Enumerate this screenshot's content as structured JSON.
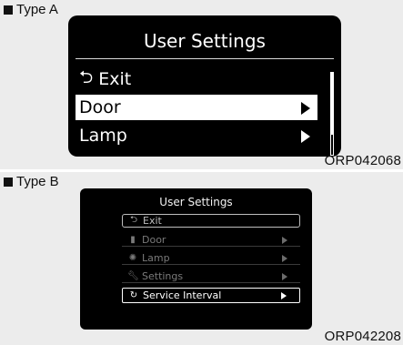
{
  "type_a": {
    "label": "Type A",
    "code": "ORP042068",
    "screen_title": "User Settings",
    "items": [
      {
        "label": "Exit",
        "icon": "back-arrow-icon",
        "has_arrow": false,
        "selected": false
      },
      {
        "label": "Door",
        "icon": "",
        "has_arrow": true,
        "selected": true
      },
      {
        "label": "Lamp",
        "icon": "",
        "has_arrow": true,
        "selected": false
      }
    ]
  },
  "type_b": {
    "label": "Type B",
    "code": "ORP042208",
    "screen_title": "User Settings",
    "items": [
      {
        "label": "Exit",
        "icon": "back-arrow-icon",
        "has_arrow": false,
        "state": "highlight"
      },
      {
        "label": "Door",
        "icon": "door-icon",
        "has_arrow": true,
        "state": "dim"
      },
      {
        "label": "Lamp",
        "icon": "lamp-icon",
        "has_arrow": true,
        "state": "dim"
      },
      {
        "label": "Settings",
        "icon": "wrench-icon",
        "has_arrow": true,
        "state": "dim"
      },
      {
        "label": "Service Interval",
        "icon": "service-icon",
        "has_arrow": true,
        "state": "selected"
      }
    ]
  },
  "colors": {
    "panel_bg": "#ececec",
    "screen_bg": "#000000",
    "selected_bg": "#ffffff",
    "dim_text": "#7a7a7a"
  }
}
